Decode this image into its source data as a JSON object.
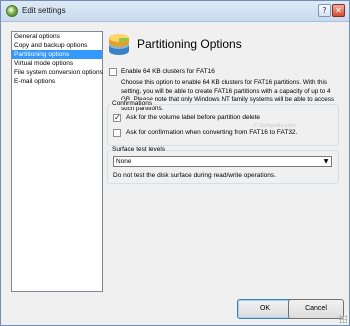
{
  "window": {
    "title": "Edit settings",
    "help_glyph": "?",
    "close_glyph": "✕"
  },
  "nav": {
    "items": [
      {
        "label": "General options"
      },
      {
        "label": "Copy and backup options"
      },
      {
        "label": "Partitioning options"
      },
      {
        "label": "Virtual mode options"
      },
      {
        "label": "File system conversion options"
      },
      {
        "label": "E-mail options"
      }
    ],
    "selected_index": 2
  },
  "panel": {
    "title": "Partitioning Options",
    "icon": "partition-disks-icon",
    "fat16": {
      "label": "Enable 64 KB clusters for FAT16",
      "checked": false,
      "description": "Choose this option to enable 64 KB clusters for FAT16 partitions. With this setting, you will be able to create FAT16 partitions with a capacity of up to 4 GB. Please note that only Windows NT family systems will be able to access such partitions."
    },
    "confirmations": {
      "title": "Confirmations",
      "items": [
        {
          "label": "Ask for the volume label before partition delete",
          "checked": true
        },
        {
          "label": "Ask for confirmation when converting from FAT16 to FAT32.",
          "checked": false
        }
      ]
    },
    "surface": {
      "title": "Surface test levels",
      "selected": "None",
      "hint": "Do not test the disk surface during read/write operations."
    }
  },
  "watermark": "© Softpedia.com",
  "buttons": {
    "ok": "OK",
    "cancel": "Cancel"
  },
  "colors": {
    "selection": "#3399ff",
    "title_gradient_top": "#dfe9f5",
    "title_gradient_bottom": "#c9daee"
  }
}
